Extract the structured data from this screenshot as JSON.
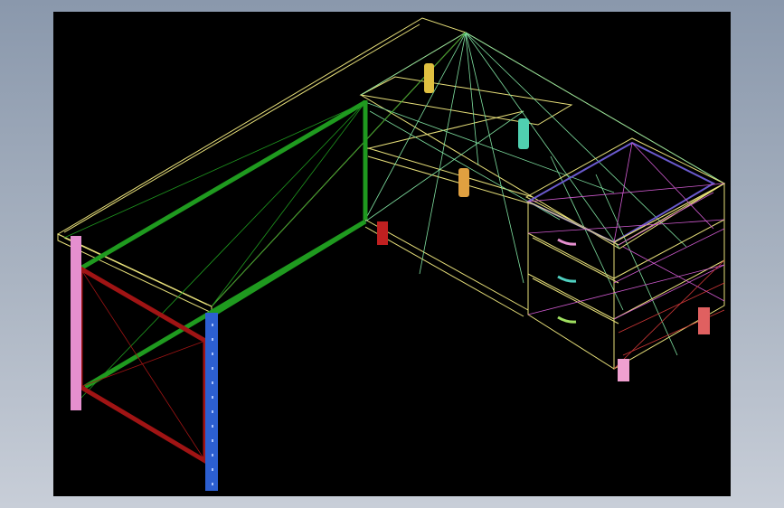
{
  "viewport": {
    "background": "#000000",
    "frame_background": "#a6b1bf"
  },
  "model": {
    "name": "",
    "colors": {
      "tabletop_outline": "#e8e07a",
      "frame_rail": "#1f9a1f",
      "left_end_frame": "#a01414",
      "leg_left": "#e58fcf",
      "leg_front": "#2c5fd1",
      "drawer_outline": "#e8e07a",
      "drawer_top_panel": "#6a5acd",
      "drawer_diagonals": "#d05ad0",
      "drawer_side_diagonals": "#d03838",
      "handle_1": "#e58fcf",
      "handle_2": "#4fd0c0",
      "handle_3": "#a0e060",
      "return_diagonals": "#7fe0a0",
      "support_yellow": "#e0c040",
      "support_cyan": "#50d0b0",
      "support_orange": "#e0a040",
      "foot_red": "#c02020",
      "foot_salmon": "#e06060",
      "foot_pink": "#f0a0d0"
    }
  }
}
